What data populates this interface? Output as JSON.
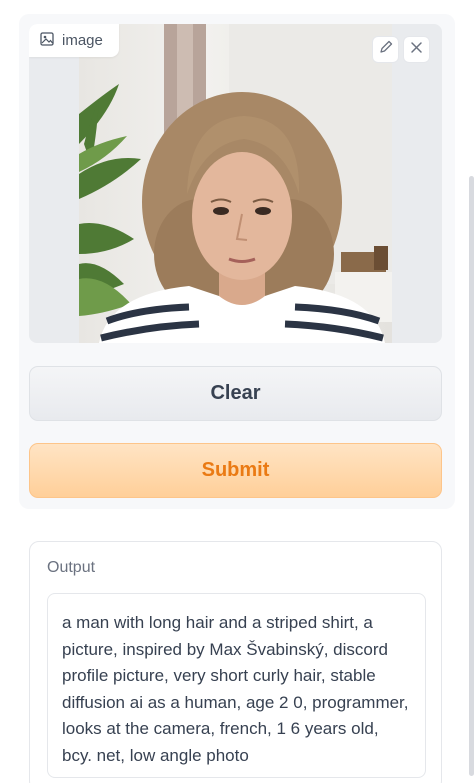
{
  "image_component": {
    "label": "image",
    "label_icon": "image-icon",
    "edit_icon": "pencil-icon",
    "close_icon": "close-icon",
    "photo_alt": "portrait photo"
  },
  "buttons": {
    "clear_label": "Clear",
    "submit_label": "Submit"
  },
  "output": {
    "label": "Output",
    "text": "a man with long hair and a striped shirt, a picture, inspired by Max Švabinský, discord profile picture, very short curly hair, stable diffusion ai as a human, age 2 0, programmer, looks at the camera, french, 1 6 years old, bcy. net, low angle photo"
  },
  "colors": {
    "submit_text": "#ea7a14",
    "submit_bg": "#ffd6a6",
    "clear_bg": "#eceef1"
  }
}
